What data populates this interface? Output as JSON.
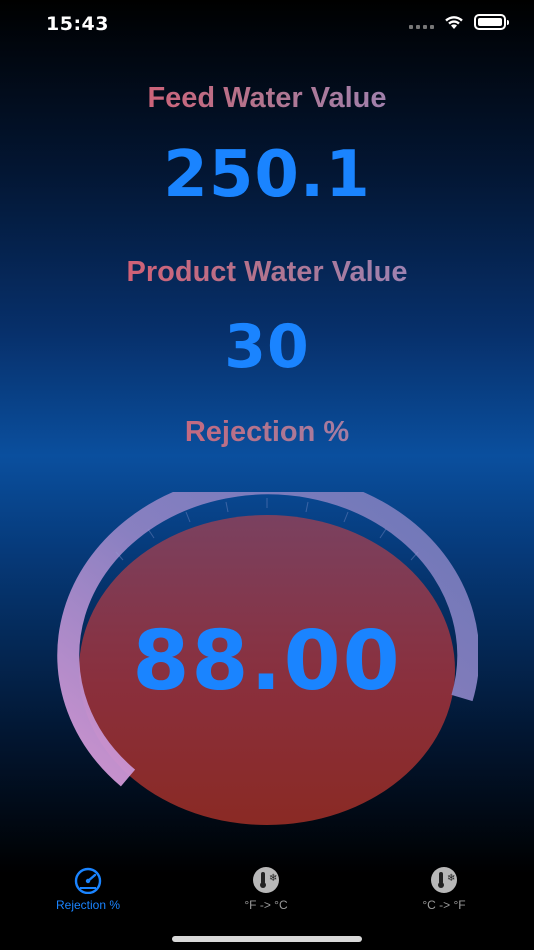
{
  "status_bar": {
    "time": "15:43"
  },
  "feed": {
    "label": "Feed Water Value",
    "value": "250.1"
  },
  "product": {
    "label": "Product Water Value",
    "value": "30"
  },
  "rejection": {
    "label": "Rejection %",
    "value": "88.00",
    "percent": 88.0
  },
  "tabs": [
    {
      "label": "Rejection %",
      "icon": "speedometer-icon",
      "active": true
    },
    {
      "label": "°F -> °C",
      "icon": "thermometer-snowflake-icon",
      "active": false
    },
    {
      "label": "°C -> °F",
      "icon": "thermometer-snowflake-icon",
      "active": false
    }
  ],
  "colors": {
    "accent_blue": "#1a84ff",
    "label_gradient_start": "#ef4e5f",
    "label_gradient_end": "#8d8ed0",
    "gauge_dial": "#8e2a2e"
  }
}
